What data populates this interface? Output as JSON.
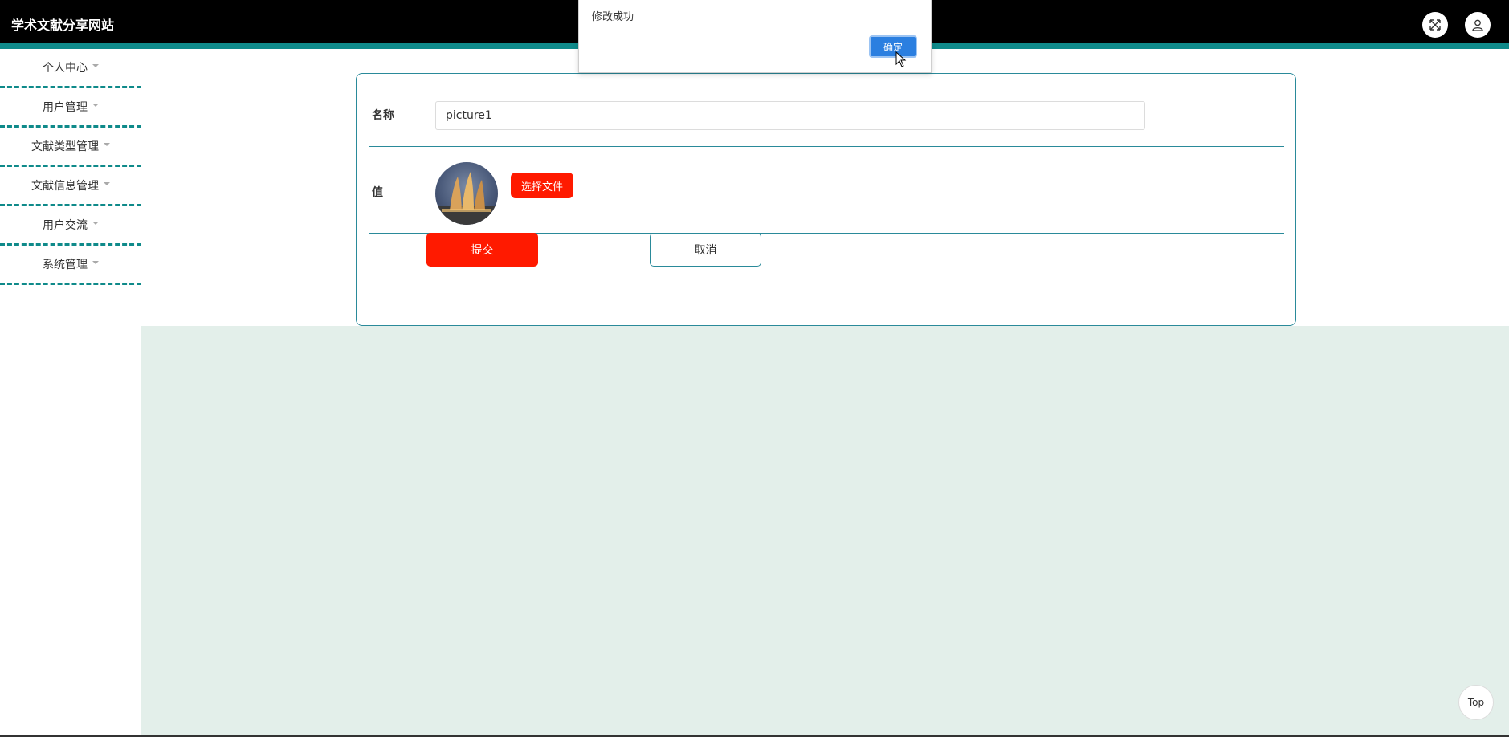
{
  "header": {
    "app_title": "学术文献分享网站"
  },
  "icons": {
    "fullscreen": "fullscreen-icon",
    "user": "user-icon"
  },
  "sidebar": {
    "items": [
      {
        "label": "个人中心"
      },
      {
        "label": "用户管理"
      },
      {
        "label": "文献类型管理"
      },
      {
        "label": "文献信息管理"
      },
      {
        "label": "用户交流"
      },
      {
        "label": "系统管理"
      }
    ]
  },
  "form": {
    "name_label": "名称",
    "name_value": "picture1",
    "value_label": "值",
    "choose_file_label": "选择文件",
    "submit_label": "提交",
    "cancel_label": "取消"
  },
  "dialog": {
    "message": "修改成功",
    "ok_label": "确定"
  },
  "misc": {
    "top_label": "Top"
  },
  "colors": {
    "accent": "#0f8a8a",
    "primary_red": "#ff1a00",
    "dialog_blue": "#2b7fe0",
    "content_bg": "#e3efea"
  }
}
